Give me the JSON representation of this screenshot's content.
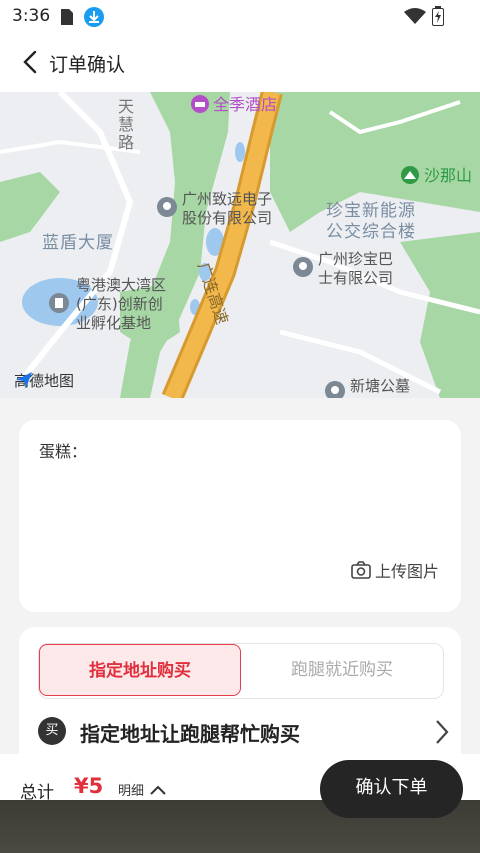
{
  "status_bar": {
    "time": "3:36"
  },
  "header": {
    "title": "订单确认"
  },
  "map": {
    "hotel": "全季酒店",
    "mountain": "沙那山",
    "street": "天慧路",
    "company1_line1": "广州致远电子",
    "company1_line2": "股份有限公司",
    "zhenbao_energy_line1": "珍宝新能源",
    "zhenbao_energy_line2": "公交综合楼",
    "zhenbao_bus_line1": "广州珍宝巴",
    "zhenbao_bus_line2": "士有限公司",
    "landun": "蓝盾大厦",
    "incubator_line1": "粤港澳大湾区",
    "incubator_line2": "(广东)创新创",
    "incubator_line3": "业孵化基地",
    "highway": "广连高速",
    "xintang": "新塘公墓",
    "logo": "高德地图"
  },
  "note": {
    "label": "蛋糕：",
    "upload": "上传图片"
  },
  "purchase": {
    "tab_active": "指定地址购买",
    "tab_inactive": "跑腿就近购买",
    "badge": "买",
    "description": "指定地址让跑腿帮忙购买"
  },
  "footer": {
    "total_label": "总计",
    "price": "¥5",
    "detail": "明细",
    "confirm": "确认下单"
  },
  "colors": {
    "accent": "#e0303d",
    "map_green": "#a6d7a4",
    "highway": "#f2b84b"
  }
}
